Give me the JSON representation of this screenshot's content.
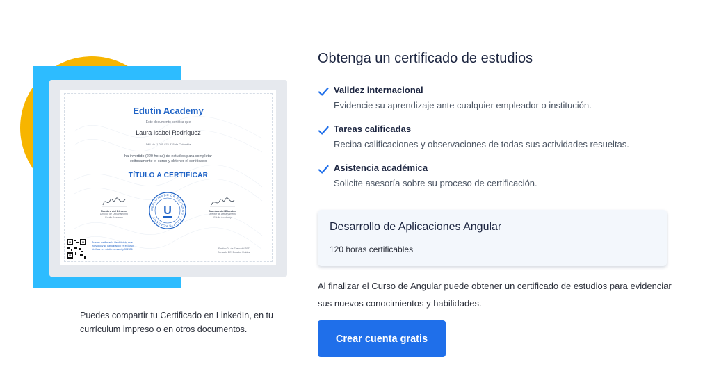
{
  "certificate": {
    "academy": "Edutin Academy",
    "certifies_line": "Este documento certifica que",
    "student_name": "Laura Isabel Rodríguez",
    "id_line": "DNI No. 1.045.876.876 de Colombia",
    "description_line1": "ha invertido (220 horas) de estudios para completar",
    "description_line2": "exitosamente el curso y obtener el certificado",
    "title": "TÍTULO A CERTIFICAR",
    "signature_left": {
      "role": "Nombre del Director",
      "sub1": "Director de Departamento",
      "sub2": "Edutin Academy"
    },
    "signature_right": {
      "role": "Nombre del Director",
      "sub1": "Director de Departamento",
      "sub2": "Edutin Academy"
    },
    "seal_text": "CERTIFICADO DE ESTUDIOS · EDUTIN ACADEMY",
    "seal_letter": "U",
    "qr_text_line1": "Puedes confirmar la identidad de este",
    "qr_text_line2": "individuo y su participación en el curso.",
    "qr_text_line3": "Verificar en: edutin.com/verify/302336",
    "issue_line1": "Emitido 01 de Enero del 2022",
    "issue_line2": "Newark, DE, Estados Unidos"
  },
  "left_caption": "Puedes compartir tu Certificado en LinkedIn, en tu currículum impreso o en otros documentos.",
  "heading": "Obtenga un certificado de estudios",
  "benefits": [
    {
      "title": "Validez internacional",
      "description": "Evidencie su aprendizaje ante cualquier empleador o institución."
    },
    {
      "title": "Tareas calificadas",
      "description": "Reciba calificaciones y observaciones de todas sus actividades resueltas."
    },
    {
      "title": "Asistencia académica",
      "description": "Solicite asesoría sobre su proceso de certificación."
    }
  ],
  "course": {
    "name": "Desarrollo de Aplicaciones Angular",
    "hours": "120 horas certificables"
  },
  "final_text": "Al finalizar el Curso de Angular puede obtener un certificado de estudios para evidenciar sus nuevos conocimientos y habilidades.",
  "cta_label": "Crear cuenta gratis",
  "colors": {
    "accent_blue": "#1f6fea",
    "decor_yellow": "#f7b500",
    "decor_cyan": "#2dbcff",
    "certificate_blue": "#1f63c6"
  },
  "icons": {
    "benefit_check": "check-icon"
  }
}
